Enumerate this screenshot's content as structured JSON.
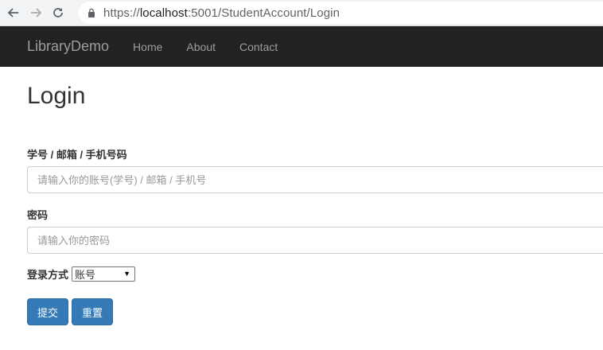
{
  "browser": {
    "url_base": "https://",
    "url_host": "localhost",
    "url_rest": ":5001/StudentAccount/Login"
  },
  "navbar": {
    "brand": "LibraryDemo",
    "links": [
      "Home",
      "About",
      "Contact"
    ]
  },
  "page": {
    "title": "Login"
  },
  "form": {
    "account_label": "学号 / 邮箱 / 手机号码",
    "account_placeholder": "请输入你的账号(学号) / 邮箱 / 手机号",
    "password_label": "密码",
    "password_placeholder": "请输入你的密码",
    "login_type_label": "登录方式",
    "login_type_value": "账号",
    "submit_label": "提交",
    "reset_label": "重置"
  }
}
